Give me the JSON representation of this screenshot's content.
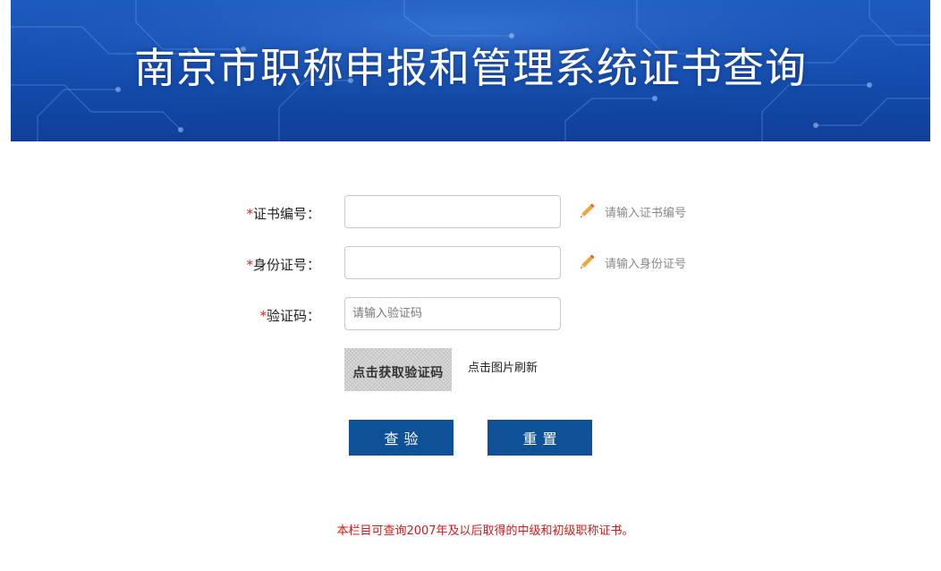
{
  "banner": {
    "title": "南京市职称申报和管理系统证书查询"
  },
  "form": {
    "required_mark": "*",
    "cert_no": {
      "label": "证书编号",
      "colon": "：",
      "value": "",
      "hint": "请输入证书编号",
      "icon": "pencil-icon"
    },
    "id_no": {
      "label": "身份证号",
      "colon": "：",
      "value": "",
      "hint": "请输入身份证号",
      "icon": "pencil-icon"
    },
    "captcha": {
      "label": "验证码",
      "colon": "：",
      "value": "",
      "placeholder": "请输入验证码"
    },
    "captcha_image": {
      "text": "点击获取验证码",
      "refresh_text": "点击图片刷新"
    }
  },
  "buttons": {
    "query_label": "查验",
    "reset_label": "重置"
  },
  "notice": "本栏目可查询2007年及以后取得的中级和初级职称证书。",
  "colors": {
    "banner": "#1550b4",
    "button": "#0e5196",
    "required": "#e02020",
    "notice": "#d11a1a"
  }
}
